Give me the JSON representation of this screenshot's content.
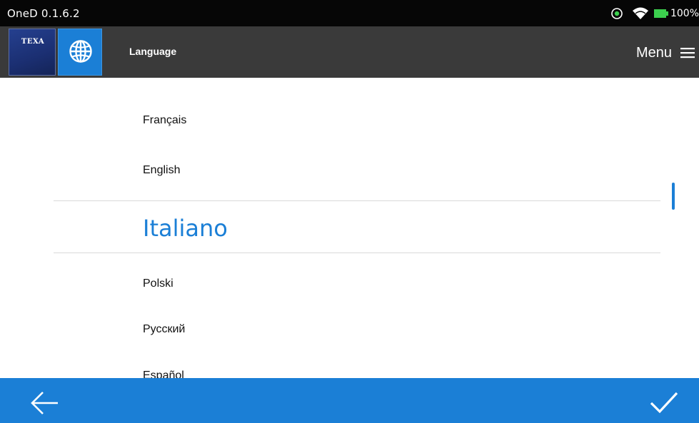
{
  "status_bar": {
    "app_version": "OneD 0.1.6.2",
    "battery": "100%",
    "icons": [
      "location-icon",
      "wifi-icon",
      "battery-icon"
    ]
  },
  "header": {
    "logo_text": "TEXA",
    "section_icon": "globe-icon",
    "title": "Language",
    "menu_label": "Menu",
    "menu_icon": "hamburger-icon"
  },
  "languages": {
    "items": [
      {
        "label": "Français"
      },
      {
        "label": "English"
      },
      {
        "label": "Italiano",
        "selected": true
      },
      {
        "label": "Polski"
      },
      {
        "label": "Русский"
      },
      {
        "label": "Español"
      }
    ]
  },
  "footer": {
    "back_icon": "arrow-left-icon",
    "confirm_icon": "checkmark-icon"
  },
  "colors": {
    "accent": "#1b7fd6",
    "header_bg": "#3a3a3a",
    "status_bg": "#060606",
    "logo_bg": "#1f3a85",
    "battery_green": "#3ccf4e"
  }
}
